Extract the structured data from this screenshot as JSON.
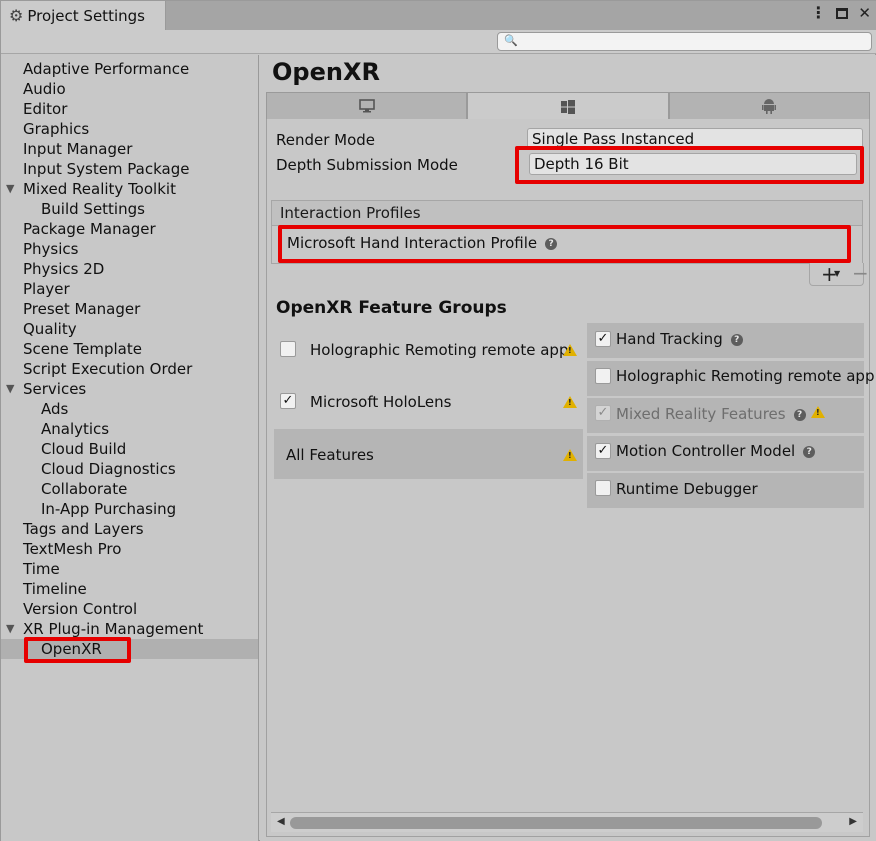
{
  "window": {
    "tab_title": "Project Settings",
    "search_placeholder": ""
  },
  "sidebar": {
    "items": [
      {
        "label": "Adaptive Performance",
        "indent": 0
      },
      {
        "label": "Audio",
        "indent": 0
      },
      {
        "label": "Editor",
        "indent": 0
      },
      {
        "label": "Graphics",
        "indent": 0
      },
      {
        "label": "Input Manager",
        "indent": 0
      },
      {
        "label": "Input System Package",
        "indent": 0
      },
      {
        "label": "Mixed Reality Toolkit",
        "indent": 0,
        "expanded": true
      },
      {
        "label": "Build Settings",
        "indent": 1
      },
      {
        "label": "Package Manager",
        "indent": 0
      },
      {
        "label": "Physics",
        "indent": 0
      },
      {
        "label": "Physics 2D",
        "indent": 0
      },
      {
        "label": "Player",
        "indent": 0
      },
      {
        "label": "Preset Manager",
        "indent": 0
      },
      {
        "label": "Quality",
        "indent": 0
      },
      {
        "label": "Scene Template",
        "indent": 0
      },
      {
        "label": "Script Execution Order",
        "indent": 0
      },
      {
        "label": "Services",
        "indent": 0,
        "expanded": true
      },
      {
        "label": "Ads",
        "indent": 1
      },
      {
        "label": "Analytics",
        "indent": 1
      },
      {
        "label": "Cloud Build",
        "indent": 1
      },
      {
        "label": "Cloud Diagnostics",
        "indent": 1
      },
      {
        "label": "Collaborate",
        "indent": 1
      },
      {
        "label": "In-App Purchasing",
        "indent": 1
      },
      {
        "label": "Tags and Layers",
        "indent": 0
      },
      {
        "label": "TextMesh Pro",
        "indent": 0
      },
      {
        "label": "Time",
        "indent": 0
      },
      {
        "label": "Timeline",
        "indent": 0
      },
      {
        "label": "Version Control",
        "indent": 0
      },
      {
        "label": "XR Plug-in Management",
        "indent": 0,
        "expanded": true
      },
      {
        "label": "OpenXR",
        "indent": 1,
        "selected": true
      }
    ]
  },
  "main": {
    "title": "OpenXR",
    "platform_tabs": [
      {
        "icon": "monitor-icon",
        "active": false
      },
      {
        "icon": "windows-icon",
        "active": true
      },
      {
        "icon": "android-icon",
        "active": false
      }
    ],
    "render_mode_label": "Render Mode",
    "render_mode_value": "Single Pass Instanced",
    "depth_mode_label": "Depth Submission Mode",
    "depth_mode_value": "Depth 16 Bit",
    "interaction_profiles_header": "Interaction Profiles",
    "interaction_profile_item": "Microsoft Hand Interaction Profile",
    "plus_label": "+",
    "minus_label": "−",
    "feature_groups_title": "OpenXR Feature Groups",
    "groups": [
      {
        "label": "Holographic Remoting remote app",
        "checked": false,
        "warning": true
      },
      {
        "label": "Microsoft HoloLens",
        "checked": true,
        "warning": true
      },
      {
        "label": "All Features",
        "warning": true
      }
    ],
    "features": [
      {
        "label": "Hand Tracking",
        "checked": true,
        "help": true
      },
      {
        "label": "Holographic Remoting remote app",
        "checked": false
      },
      {
        "label": "Mixed Reality Features",
        "checked": true,
        "disabled": true,
        "help": true,
        "warning": true
      },
      {
        "label": "Motion Controller Model",
        "checked": true,
        "help": true
      },
      {
        "label": "Runtime Debugger",
        "checked": false
      }
    ]
  },
  "colors": {
    "highlight": "#e60000",
    "warning": "#e1b100",
    "selected_row": "#b0b0b0"
  }
}
